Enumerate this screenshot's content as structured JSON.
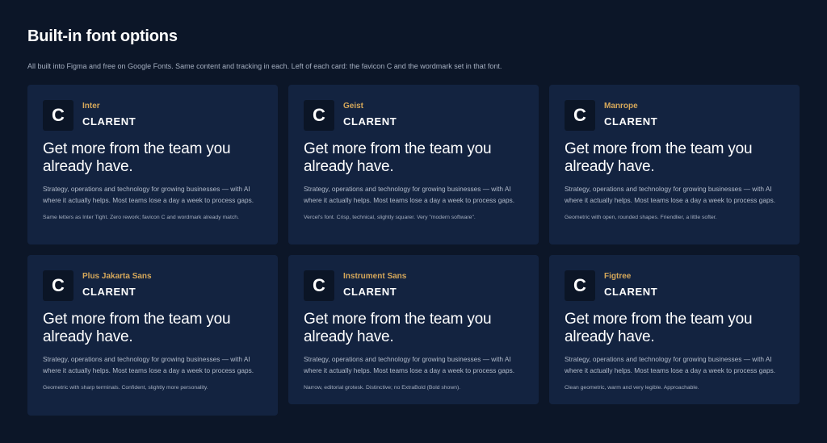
{
  "header": {
    "title": "Built-in font options",
    "subtitle": "All built into Figma and free on Google Fonts. Same content and tracking in each. Left of each card: the favicon C and the wordmark set in that font."
  },
  "colors": {
    "background": "#0c1628",
    "card": "#132340",
    "favicon_bg": "#0b1526",
    "accent": "#d6a85a"
  },
  "cards": [
    {
      "favicon": "C",
      "font_name": "Inter",
      "wordmark": "CLARENT",
      "headline": "Get more from the team you already have.",
      "body": "Strategy, operations and technology for growing businesses — with AI where it actually helps. Most teams lose a day a week to process gaps.",
      "note": "Same letters as Inter Tight. Zero rework; favicon C and wordmark already match."
    },
    {
      "favicon": "C",
      "font_name": "Geist",
      "wordmark": "CLARENT",
      "headline": "Get more from the team you already have.",
      "body": "Strategy, operations and technology for growing businesses — with AI where it actually helps. Most teams lose a day a week to process gaps.",
      "note": "Vercel's font. Crisp, technical, slightly squarer. Very \"modern software\"."
    },
    {
      "favicon": "C",
      "font_name": "Manrope",
      "wordmark": "CLARENT",
      "headline": "Get more from the team you already have.",
      "body": "Strategy, operations and technology for growing businesses — with AI where it actually helps. Most teams lose a day a week to process gaps.",
      "note": "Geometric with open, rounded shapes. Friendlier, a little softer."
    },
    {
      "favicon": "C",
      "font_name": "Plus Jakarta Sans",
      "wordmark": "CLARENT",
      "headline": "Get more from the team you already have.",
      "body": "Strategy, operations and technology for growing businesses — with AI where it actually helps. Most teams lose a day a week to process gaps.",
      "note": "Geometric with sharp terminals. Confident, slightly more personality."
    },
    {
      "favicon": "C",
      "font_name": "Instrument Sans",
      "wordmark": "CLARENT",
      "headline": "Get more from the team you already have.",
      "body": "Strategy, operations and technology for growing businesses — with AI where it actually helps. Most teams lose a day a week to process gaps.",
      "note": "Narrow, editorial grotesk. Distinctive; no ExtraBold (Bold shown)."
    },
    {
      "favicon": "C",
      "font_name": "Figtree",
      "wordmark": "CLARENT",
      "headline": "Get more from the team you already have.",
      "body": "Strategy, operations and technology for growing businesses — with AI where it actually helps. Most teams lose a day a week to process gaps.",
      "note": "Clean geometric, warm and very legible. Approachable."
    }
  ]
}
